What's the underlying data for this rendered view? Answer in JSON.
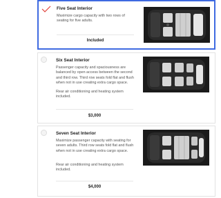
{
  "options": [
    {
      "title": "Five Seat Interior",
      "description": "Maximize cargo capacity with two rows of seating for five adults.",
      "note": "",
      "price": "Included",
      "selected": true,
      "image": "five-seat-interior-top-view"
    },
    {
      "title": "Six Seat Interior",
      "description": "Passenger capacity and spaciousness are balanced by open access between the second and third row. Third row seats fold flat and flush when not in use creating extra cargo space.",
      "note": "Rear air conditioning and heating system included.",
      "price": "$3,000",
      "selected": false,
      "image": "six-seat-interior-top-view"
    },
    {
      "title": "Seven Seat Interior",
      "description": "Maximize passenger capacity with seating for seven adults. Third row seats fold flat and flush when not in use creating extra cargo space.",
      "note": "Rear air conditioning and heating system included.",
      "price": "$4,000",
      "selected": false,
      "image": "seven-seat-interior-top-view"
    }
  ],
  "colors": {
    "selected_border": "#3e6ae1",
    "checkmark": "#e0413a"
  }
}
